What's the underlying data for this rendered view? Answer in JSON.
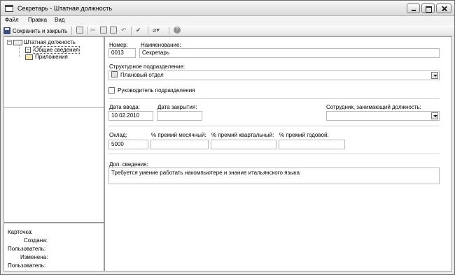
{
  "window": {
    "title": "Секретарь - Штатная должность"
  },
  "menu": [
    "Файл",
    "Правка",
    "Вид"
  ],
  "toolbar": {
    "save_label": "Сохранить и закрыть"
  },
  "tree": {
    "root": "Штатная должность",
    "items": [
      "Общие сведения",
      "Приложения"
    ]
  },
  "info": {
    "card": "Карточка:",
    "created": "Создана:",
    "user1": "Пользователь:",
    "changed": "Изменена:",
    "user2": "Пользователь:"
  },
  "form": {
    "number_label": "Номер:",
    "number_value": "0013",
    "name_label": "Наименование:",
    "name_value": "Секретарь",
    "dept_label": "Структурное подразделение:",
    "dept_value": "Плановый отдел",
    "head_label": "Руководитель подразделения",
    "date_in_label": "Дата ввода:",
    "date_in_value": "10.02.2010",
    "date_close_label": "Дата закрытия:",
    "date_close_value": "",
    "employee_label": "Сотрудник, занимающий должность:",
    "employee_value": "",
    "salary_label": "Оклад:",
    "salary_value": "5000",
    "bonus_month_label": "% премий месячный:",
    "bonus_quarter_label": "% премий квартальный:",
    "bonus_year_label": "% премий годовой:",
    "extra_label": "Доп. сведения:",
    "extra_value": "Требуется умение работать накомпьютере и знание итальянского языка"
  }
}
